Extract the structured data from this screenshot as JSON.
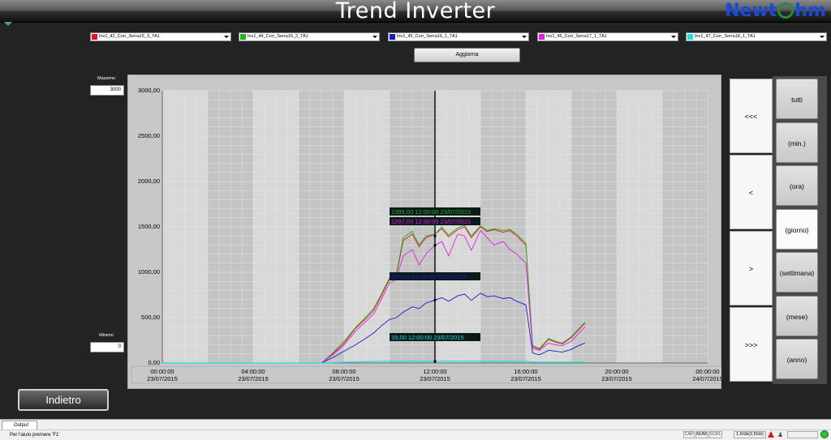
{
  "app": {
    "title": "Trend Inverter",
    "logo": {
      "left": "Newt",
      "right": "hm"
    }
  },
  "series": [
    {
      "name": "Inv1_42_Corr_Serra15_3_TA1",
      "color": "#e8121c"
    },
    {
      "name": "Inv1_44_Corr_Serra16_2_TA1",
      "color": "#1fb21f"
    },
    {
      "name": "Inv1_45_Corr_Serra16_1_TA1",
      "color": "#1a1acc"
    },
    {
      "name": "Inv1_46_Corr_Serra17_1_TA1",
      "color": "#e01ee0"
    },
    {
      "name": "Inv1_47_Corr_Serra18_1_TA1",
      "color": "#17e0e0"
    }
  ],
  "toolbar": {
    "refresh_label": "Aggiorna"
  },
  "range": {
    "max_label": "Massimo",
    "max_value": "3000",
    "min_label": "Minimo",
    "min_value": "0"
  },
  "navigation": {
    "first": "<<<",
    "prev": "<",
    "next": ">",
    "last": ">>>"
  },
  "scales": [
    {
      "label": "tutti",
      "active": false
    },
    {
      "label": "(min.)",
      "active": false
    },
    {
      "label": "(ora)",
      "active": false
    },
    {
      "label": "(giorno)",
      "active": true
    },
    {
      "label": "(settimana)",
      "active": false
    },
    {
      "label": "(mese)",
      "active": false
    },
    {
      "label": "(anno)",
      "active": false
    }
  ],
  "back_label": "Indietro",
  "output_tab": "Output",
  "status": {
    "help": "Per l'aiuto premere 'F1'",
    "cap": "CAP",
    "num": "NUM",
    "scrl": "SCRL",
    "memory": "1,6Gb(2,5Gb)"
  },
  "chart_data": {
    "type": "line",
    "ylim": [
      0,
      3000
    ],
    "yticks": [
      "0,00",
      "500,00",
      "1000,00",
      "1500,00",
      "2000,00",
      "2500,00",
      "3000,00"
    ],
    "ytick_values": [
      0,
      500,
      1000,
      1500,
      2000,
      2500,
      3000
    ],
    "xlim_hours": [
      0,
      24
    ],
    "xticks": [
      {
        "hour": 0,
        "time": "00:00:00",
        "date": "23/07/2015"
      },
      {
        "hour": 4,
        "time": "04:00:00",
        "date": "23/07/2015"
      },
      {
        "hour": 8,
        "time": "08:00:00",
        "date": "23/07/2015"
      },
      {
        "hour": 12,
        "time": "12:00:00",
        "date": "23/07/2015"
      },
      {
        "hour": 16,
        "time": "16:00:00",
        "date": "23/07/2015"
      },
      {
        "hour": 20,
        "time": "20:00:00",
        "date": "23/07/2015"
      },
      {
        "hour": 24,
        "time": "00:00:00",
        "date": "24/07/2015"
      }
    ],
    "cursor_hour": 12,
    "cursor_labels": [
      {
        "series": 1,
        "text": "1399,00 12:00:00 23/07/2015",
        "value": 1399
      },
      {
        "series": 3,
        "text": "1297,00 12:00:00 23/07/2015",
        "value": 1297
      },
      {
        "series": 2,
        "text": "694,00 12:00:00 23/07/2015",
        "value": 694
      },
      {
        "series": 4,
        "text": "19,00 12:00:00 23/07/2015",
        "value": 19
      }
    ],
    "x": [
      7,
      7.5,
      8,
      8.5,
      9,
      9.3,
      9.6,
      10,
      10.3,
      10.6,
      11,
      11.3,
      11.6,
      12,
      12.3,
      12.6,
      13,
      13.3,
      13.6,
      14,
      14.3,
      14.6,
      15,
      15.3,
      15.6,
      16,
      16.3,
      16.6,
      17,
      17.3,
      17.6,
      18,
      18.3,
      18.6
    ],
    "values_by_series": {
      "0": [
        0,
        100,
        220,
        380,
        500,
        580,
        720,
        920,
        960,
        1350,
        1420,
        1280,
        1380,
        1420,
        1480,
        1390,
        1470,
        1500,
        1380,
        1500,
        1450,
        1470,
        1440,
        1460,
        1400,
        1300,
        180,
        150,
        260,
        230,
        210,
        280,
        360,
        440
      ],
      "1": [
        0,
        110,
        240,
        390,
        520,
        600,
        740,
        940,
        980,
        1380,
        1450,
        1300,
        1399,
        1420,
        1500,
        1410,
        1490,
        1520,
        1400,
        1510,
        1460,
        1480,
        1460,
        1470,
        1420,
        1320,
        190,
        160,
        270,
        240,
        220,
        290,
        370,
        450
      ],
      "2": [
        0,
        60,
        130,
        200,
        280,
        330,
        400,
        480,
        500,
        560,
        620,
        600,
        660,
        694,
        720,
        680,
        740,
        760,
        690,
        770,
        730,
        740,
        710,
        720,
        680,
        640,
        110,
        90,
        140,
        130,
        120,
        150,
        190,
        220
      ],
      "3": [
        0,
        90,
        200,
        350,
        470,
        540,
        680,
        880,
        920,
        1180,
        1250,
        1080,
        1200,
        1297,
        1340,
        1180,
        1420,
        1400,
        1240,
        1460,
        1380,
        1300,
        1340,
        1250,
        1200,
        1100,
        160,
        140,
        220,
        200,
        190,
        240,
        320,
        400
      ],
      "4": [
        0,
        4,
        8,
        12,
        15,
        16,
        17,
        18,
        18,
        19,
        19,
        19,
        19,
        19,
        19,
        19,
        19,
        19,
        19,
        19,
        19,
        19,
        19,
        19,
        19,
        18,
        10,
        8,
        8,
        8,
        8,
        8,
        8,
        8
      ]
    }
  }
}
